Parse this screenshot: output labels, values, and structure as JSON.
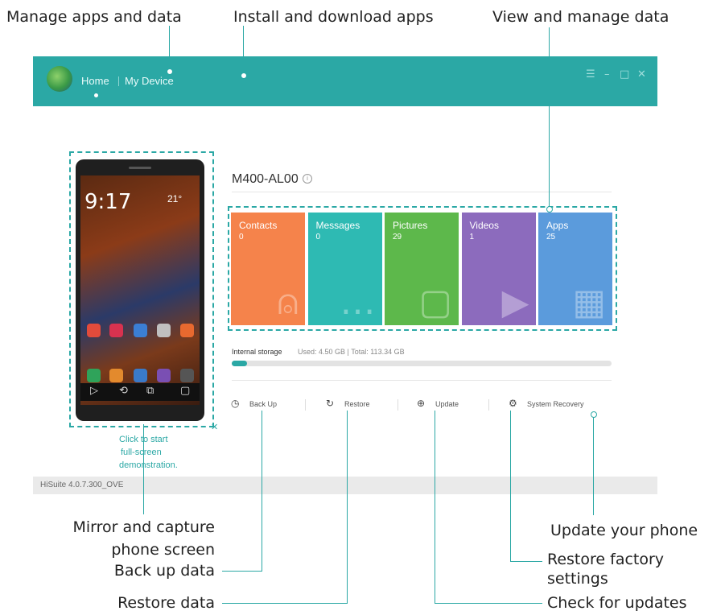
{
  "callouts": {
    "manage_apps": "Manage apps and data",
    "install_apps": "Install and download apps",
    "view_data": "View and manage data",
    "mirror_line1": "Mirror and capture",
    "mirror_line2": "phone screen",
    "back_up": "Back up data",
    "restore": "Restore data",
    "update_phone": "Update your phone",
    "restore_factory_line1": "Restore factory",
    "restore_factory_line2": "settings",
    "check_updates": "Check for updates"
  },
  "window": {
    "nav_home": "Home",
    "nav_my_device": "My Device",
    "controls": [
      "☰",
      "–",
      "□",
      "✕"
    ],
    "version": "HiSuite 4.0.7.300_OVE"
  },
  "phone": {
    "time": "9:17",
    "temp": "21°",
    "hint_line1": "Click to start",
    "hint_line2": "full-screen",
    "hint_line3": "demonstration.",
    "close": "✕",
    "nav_icons": [
      "▷",
      "⟲",
      "⧉",
      "▢"
    ]
  },
  "device": {
    "name": "M400-AL00",
    "info_icon": "i",
    "tiles": [
      {
        "label": "Contacts",
        "count": "0",
        "color": "#f5834b",
        "icon": "person-icon"
      },
      {
        "label": "Messages",
        "count": "0",
        "color": "#2ebab3",
        "icon": "chat-icon"
      },
      {
        "label": "Pictures",
        "count": "29",
        "color": "#5db84b",
        "icon": "picture-icon"
      },
      {
        "label": "Videos",
        "count": "1",
        "color": "#8c6bbd",
        "icon": "video-icon"
      },
      {
        "label": "Apps",
        "count": "25",
        "color": "#5b9bdc",
        "icon": "grid-icon"
      }
    ],
    "storage_label": "Internal storage",
    "storage_stats": "Used: 4.50 GB | Total: 113.34 GB",
    "storage_fraction": 0.04
  },
  "actions": {
    "back_up": "Back Up",
    "restore": "Restore",
    "update": "Update",
    "system_recovery": "System Recovery"
  },
  "colors": {
    "accent": "#2ba8a5"
  }
}
